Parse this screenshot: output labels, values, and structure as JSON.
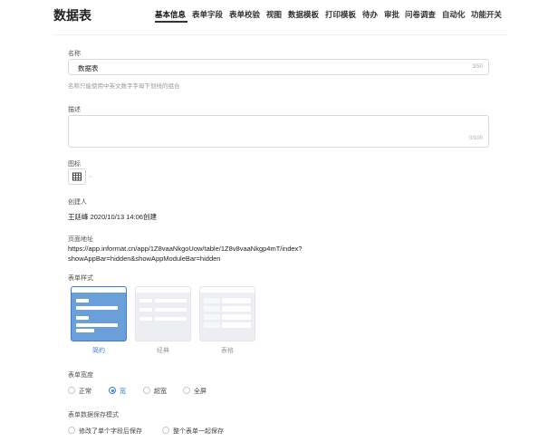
{
  "header": {
    "title": "数据表",
    "tabs": [
      "基本信息",
      "表单字段",
      "表单校验",
      "视图",
      "数据模板",
      "打印模板",
      "待办",
      "审批",
      "问卷调查",
      "自动化",
      "功能开关"
    ]
  },
  "name_field": {
    "label": "名称",
    "value": "数据表",
    "counter": "3/50",
    "hint": "名称只能使用中英文数字字母下划线的组合"
  },
  "desc_field": {
    "label": "描述",
    "value": "",
    "counter": "0/100"
  },
  "icon_field": {
    "label": "图标",
    "icon": "table-icon"
  },
  "creator": {
    "label": "创建人",
    "value": "王廷峰 2020/10/13 14:06创建"
  },
  "page_url": {
    "label": "页面地址",
    "line1": "https://app.informat.cn/app/1Z8vaaNkgoUow/table/1Z8v8vaaNkgp4mT/index?",
    "line2": "showAppBar=hidden&showAppModuleBar=hidden"
  },
  "form_style": {
    "label": "表单样式",
    "options": [
      "简约",
      "经典",
      "表格"
    ],
    "selected": "简约"
  },
  "form_width": {
    "label": "表单宽度",
    "options": [
      "正常",
      "宽",
      "超宽",
      "全屏"
    ],
    "selected": "宽"
  },
  "save_mode": {
    "label": "表单数据保存模式",
    "options": [
      "修改了单个字段后保存",
      "整个表单一起保存"
    ]
  },
  "colors": {
    "accent": "#3a7bd5",
    "card_blue": "#6a9fd8",
    "card_gray": "#eceef1"
  }
}
